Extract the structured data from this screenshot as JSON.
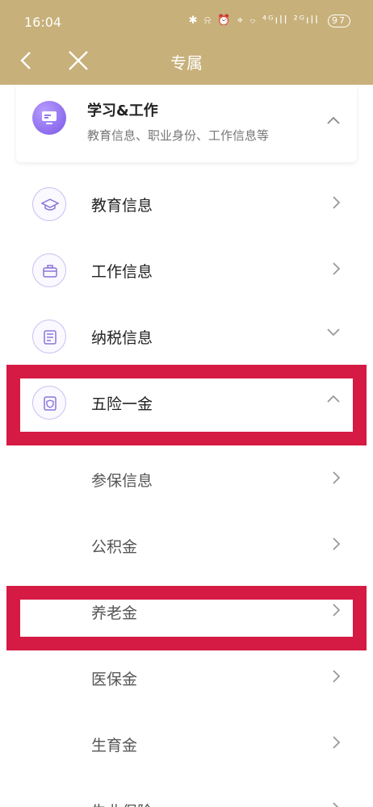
{
  "status_bar": {
    "time": "16:04",
    "icons": "✱ ⍾ ⏰ ⌖ ⌔ ⁴ᴳıll ²ᴳıll",
    "battery": "97"
  },
  "nav": {
    "title": "专属"
  },
  "section": {
    "title": "学习&工作",
    "subtitle": "教育信息、职业身份、工作信息等"
  },
  "items": [
    {
      "label": "教育信息"
    },
    {
      "label": "工作信息"
    },
    {
      "label": "纳税信息"
    },
    {
      "label": "五险一金"
    }
  ],
  "sub_items": [
    {
      "label": "参保信息"
    },
    {
      "label": "公积金"
    },
    {
      "label": "养老金"
    },
    {
      "label": "医保金"
    },
    {
      "label": "生育金"
    },
    {
      "label": "失业保险"
    }
  ],
  "colors": {
    "header": "#c7b07a",
    "highlight": "#d51a44",
    "accent": "#7a57e6"
  }
}
